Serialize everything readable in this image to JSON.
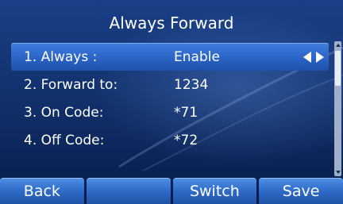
{
  "title": "Always Forward",
  "rows": [
    {
      "label": "1. Always :",
      "value": "Enable"
    },
    {
      "label": "2. Forward to:",
      "value": "1234"
    },
    {
      "label": "3. On Code:",
      "value": "*71"
    },
    {
      "label": "4. Off Code:",
      "value": "*72"
    }
  ],
  "softkeys": {
    "key1": "Back",
    "key2": "",
    "key3": "Switch",
    "key4": "Save"
  },
  "icons": {
    "left": "left-arrow-icon",
    "right": "right-arrow-icon",
    "scroll_up": "scroll-up-icon",
    "scroll_down": "scroll-down-icon"
  },
  "colors": {
    "background": "#12326e",
    "highlight": "#2a64c6",
    "softkey": "#2f6cc8",
    "text": "#ffffff"
  }
}
